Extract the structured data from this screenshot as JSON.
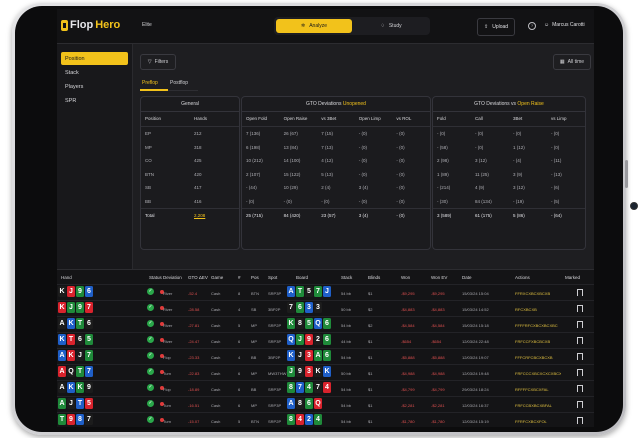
{
  "app": {
    "logo_plain": "Flop",
    "logo_accent": "Hero",
    "tier": "Elite"
  },
  "nav": {
    "tabs": [
      {
        "label": "Analyze",
        "icon": "puzzle-icon",
        "active": true
      },
      {
        "label": "Study",
        "icon": "lightbulb-icon",
        "active": false
      }
    ],
    "upload_label": "Upload",
    "help_icon": "?",
    "user_name": "Marcus Carotti"
  },
  "sidebar": {
    "items": [
      {
        "label": "Position",
        "active": true
      },
      {
        "label": "Stack"
      },
      {
        "label": "Players"
      },
      {
        "label": "SPR"
      }
    ]
  },
  "toolbar": {
    "filters_label": "Filters",
    "date_label": "All time"
  },
  "subtabs": [
    {
      "label": "Preflop",
      "active": true
    },
    {
      "label": "Postflop"
    }
  ],
  "colors": {
    "accent": "#f2c21b",
    "spades": "#1c1c1c",
    "hearts": "#d9232d",
    "diamonds": "#1f5fc8",
    "clubs": "#1f8a3a"
  },
  "panels": {
    "general": {
      "title": "General",
      "columns": [
        "Position",
        "Hands"
      ],
      "rows": [
        [
          "EP",
          "212"
        ],
        [
          "MP",
          "318"
        ],
        [
          "CO",
          "425"
        ],
        [
          "BTN",
          "420"
        ],
        [
          "SB",
          "417"
        ],
        [
          "BB",
          "416"
        ]
      ],
      "total": [
        "Total",
        "2,208"
      ]
    },
    "open": {
      "title_plain": "GTO Deviations",
      "title_accent": "Unopened",
      "columns": [
        "Open Fold",
        "Open Raise",
        "vs 3Bet",
        "Open Limp",
        "vs ROL"
      ],
      "rows": [
        [
          "7 (136)",
          "26 (67)",
          "7 (15)",
          "- (0)",
          "- (0)"
        ],
        [
          "6 (198)",
          "13 (84)",
          "7 (13)",
          "- (0)",
          "- (0)"
        ],
        [
          "10 (212)",
          "14 (100)",
          "4 (12)",
          "- (0)",
          "- (0)"
        ],
        [
          "2 (107)",
          "15 (122)",
          "5 (13)",
          "- (0)",
          "- (0)"
        ],
        [
          "- (44)",
          "10 (29)",
          "2 (4)",
          "3 (4)",
          "- (0)"
        ],
        [
          "- (0)",
          "- (0)",
          "- (0)",
          "- (0)",
          "- (0)"
        ]
      ],
      "total": [
        "25 (715)",
        "84 (420)",
        "23 (57)",
        "3 (4)",
        "- (0)"
      ]
    },
    "raise": {
      "title_plain": "GTO Deviations",
      "title_mid": "vs",
      "title_accent": "Open Raise",
      "columns": [
        "Fold",
        "Call",
        "3Bet",
        "vs Limp"
      ],
      "rows": [
        [
          "- (0)",
          "- (0)",
          "- (0)",
          "- (0)"
        ],
        [
          "- (58)",
          "- (0)",
          "1 (12)",
          "- (0)"
        ],
        [
          "2 (98)",
          "3 (12)",
          "- (4)",
          "- (11)"
        ],
        [
          "1 (89)",
          "11 (25)",
          "3 (9)",
          "- (13)"
        ],
        [
          "- (214)",
          "4 (9)",
          "3 (12)",
          "- (6)"
        ],
        [
          "- (30)",
          "84 (134)",
          "- (19)",
          "- (5)"
        ]
      ],
      "total": [
        "3 (589)",
        "61 (175)",
        "5 (86)",
        "- (64)"
      ]
    }
  },
  "table": {
    "columns": [
      "Hand",
      "Status",
      "Deviation",
      "GTO ΔEV",
      "Game",
      "#",
      "Pos",
      "Spot",
      "Board",
      "Stack",
      "Blinds",
      "Won",
      "Won EV",
      "Date",
      "Actions",
      "Marked"
    ],
    "rows": [
      {
        "hand": [
          [
            "K",
            "s"
          ],
          [
            "J",
            "h"
          ],
          [
            "9",
            "c"
          ],
          [
            "6",
            "d"
          ]
        ],
        "status": "ok",
        "dev": "River",
        "ev": "-52.4",
        "game": "Cash",
        "num": "8",
        "pos": "BTN",
        "spot": "SRP3P",
        "board": [
          [
            "A",
            "d"
          ],
          [
            "T",
            "c"
          ],
          [
            "5",
            "s"
          ],
          [
            "7",
            "c"
          ],
          [
            "J",
            "d"
          ]
        ],
        "stack": "54 bb",
        "blinds": "$1",
        "won": "-$9,295",
        "wonev": "-$9,295",
        "date": "15/03/24 15:04",
        "actions": "FFRXCXBCXBCXB"
      },
      {
        "hand": [
          [
            "K",
            "h"
          ],
          [
            "J",
            "c"
          ],
          [
            "9",
            "c"
          ],
          [
            "7",
            "h"
          ]
        ],
        "status": "ok",
        "dev": "River",
        "ev": "-28.58",
        "game": "Cash",
        "num": "4",
        "pos": "SB",
        "spot": "3BP2P",
        "board": [
          [
            "7",
            "s"
          ],
          [
            "6",
            "c"
          ],
          [
            "3",
            "d"
          ],
          [
            "3",
            "s"
          ]
        ],
        "stack": "50 bb",
        "blinds": "$2",
        "won": "-$4,883",
        "wonev": "-$4,883",
        "date": "15/03/24 14:52",
        "actions": "RFCXBCXB"
      },
      {
        "hand": [
          [
            "A",
            "s"
          ],
          [
            "K",
            "d"
          ],
          [
            "T",
            "c"
          ],
          [
            "6",
            "s"
          ]
        ],
        "status": "ok",
        "dev": "River",
        "ev": "-27.81",
        "game": "Cash",
        "num": "5",
        "pos": "MP",
        "spot": "SRP2P",
        "board": [
          [
            "K",
            "c"
          ],
          [
            "8",
            "s"
          ],
          [
            "5",
            "c"
          ],
          [
            "Q",
            "d"
          ],
          [
            "6",
            "c"
          ]
        ],
        "stack": "54 bb",
        "blinds": "$2",
        "won": "-$4,584",
        "wonev": "-$4,584",
        "date": "15/03/24 15:18",
        "actions": "FFFFRFCXBCXBCXBC"
      },
      {
        "hand": [
          [
            "K",
            "d"
          ],
          [
            "T",
            "h"
          ],
          [
            "6",
            "s"
          ],
          [
            "5",
            "c"
          ]
        ],
        "status": "ok",
        "dev": "River",
        "ev": "-24.47",
        "game": "Cash",
        "num": "6",
        "pos": "MP",
        "spot": "SRP3P",
        "board": [
          [
            "Q",
            "d"
          ],
          [
            "J",
            "c"
          ],
          [
            "9",
            "h"
          ],
          [
            "2",
            "s"
          ],
          [
            "6",
            "c"
          ]
        ],
        "stack": "44 bb",
        "blinds": "$1",
        "won": "-$654",
        "wonev": "-$654",
        "date": "12/03/24 22:48",
        "actions": "FRFCCFXBCBCXB"
      },
      {
        "hand": [
          [
            "A",
            "d"
          ],
          [
            "K",
            "h"
          ],
          [
            "J",
            "s"
          ],
          [
            "7",
            "c"
          ]
        ],
        "status": "ok",
        "dev": "Flop",
        "ev": "-23.33",
        "game": "Cash",
        "num": "4",
        "pos": "BB",
        "spot": "3BP2P",
        "board": [
          [
            "K",
            "d"
          ],
          [
            "J",
            "s"
          ],
          [
            "3",
            "h"
          ],
          [
            "A",
            "c"
          ],
          [
            "6",
            "c"
          ]
        ],
        "stack": "54 bb",
        "blinds": "$1",
        "won": "-$5,888",
        "wonev": "-$5,888",
        "date": "12/03/24 19:07",
        "actions": "FFFCRFCBCXBCXB"
      },
      {
        "hand": [
          [
            "A",
            "h"
          ],
          [
            "Q",
            "s"
          ],
          [
            "T",
            "c"
          ],
          [
            "7",
            "d"
          ]
        ],
        "status": "ok",
        "dev": "Turn",
        "ev": "-22.83",
        "game": "Cash",
        "num": "6",
        "pos": "MP",
        "spot": "MW3THW",
        "board": [
          [
            "J",
            "c"
          ],
          [
            "9",
            "s"
          ],
          [
            "3",
            "h"
          ],
          [
            "K",
            "s"
          ],
          [
            "K",
            "d"
          ]
        ],
        "stack": "50 bb",
        "blinds": "$1",
        "won": "-$4,988",
        "wonev": "-$4,988",
        "date": "12/03/24 19:48",
        "actions": "FRFCCCXBCXCXCXBCXFOL"
      },
      {
        "hand": [
          [
            "A",
            "s"
          ],
          [
            "K",
            "d"
          ],
          [
            "K",
            "c"
          ],
          [
            "9",
            "s"
          ]
        ],
        "status": "ok",
        "dev": "Flop",
        "ev": "-18.89",
        "game": "Cash",
        "num": "6",
        "pos": "BB",
        "spot": "SRP3P",
        "board": [
          [
            "8",
            "c"
          ],
          [
            "7",
            "d"
          ],
          [
            "4",
            "c"
          ],
          [
            "7",
            "s"
          ],
          [
            "4",
            "h"
          ]
        ],
        "stack": "54 bb",
        "blinds": "$1",
        "won": "-$4,799",
        "wonev": "-$4,799",
        "date": "29/03/24 18:24",
        "actions": "RFFFFCXBCXFAL"
      },
      {
        "hand": [
          [
            "A",
            "c"
          ],
          [
            "J",
            "s"
          ],
          [
            "T",
            "d"
          ],
          [
            "5",
            "h"
          ]
        ],
        "status": "ok",
        "dev": "Turn",
        "ev": "-16.51",
        "game": "Cash",
        "num": "6",
        "pos": "MP",
        "spot": "SRP3P",
        "board": [
          [
            "A",
            "d"
          ],
          [
            "8",
            "s"
          ],
          [
            "6",
            "c"
          ],
          [
            "Q",
            "h"
          ]
        ],
        "stack": "54 bb",
        "blinds": "$1",
        "won": "-$2,281",
        "wonev": "-$2,281",
        "date": "12/03/24 16:37",
        "actions": "FRFCCBXBCXBFAL"
      },
      {
        "hand": [
          [
            "T",
            "c"
          ],
          [
            "9",
            "h"
          ],
          [
            "8",
            "d"
          ],
          [
            "7",
            "s"
          ]
        ],
        "status": "ok",
        "dev": "Turn",
        "ev": "-15.07",
        "game": "Cash",
        "num": "5",
        "pos": "BTN",
        "spot": "SRP2P",
        "board": [
          [
            "8",
            "c"
          ],
          [
            "4",
            "h"
          ],
          [
            "2",
            "d"
          ],
          [
            "4",
            "c"
          ]
        ],
        "stack": "54 bb",
        "blinds": "$1",
        "won": "-$1,780",
        "wonev": "-$1,780",
        "date": "12/03/24 15:19",
        "actions": "FFRFCXBCXFOL"
      }
    ]
  }
}
